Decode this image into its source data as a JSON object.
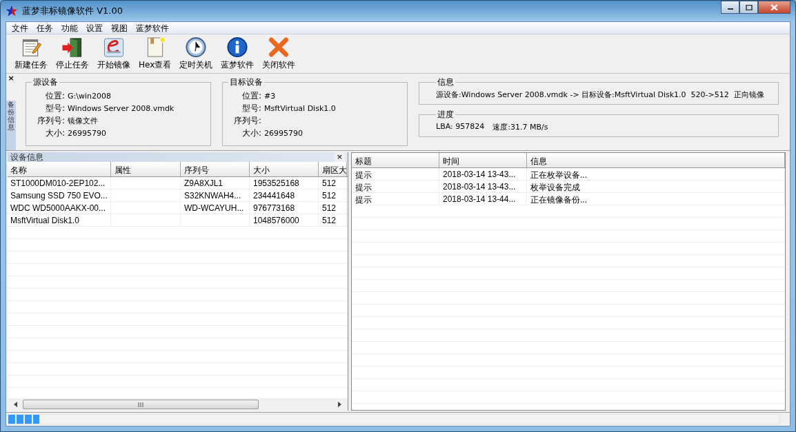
{
  "window": {
    "title": "蓝梦非标镜像软件 V1.00"
  },
  "menu": [
    "文件",
    "任务",
    "功能",
    "设置",
    "视图",
    "蓝梦软件"
  ],
  "toolbar": [
    {
      "label": "新建任务"
    },
    {
      "label": "停止任务"
    },
    {
      "label": "开始镜像"
    },
    {
      "label": "Hex查看"
    },
    {
      "label": "定时关机"
    },
    {
      "label": "蓝梦软件"
    },
    {
      "label": "关闭软件"
    }
  ],
  "side_tab": {
    "close": "×",
    "label": "备份信息"
  },
  "source": {
    "title": "源设备",
    "fields": [
      {
        "label": "位置:",
        "value": "G:\\win2008"
      },
      {
        "label": "型号:",
        "value": "Windows Server 2008.vmdk"
      },
      {
        "label": "序列号:",
        "value": "镜像文件"
      },
      {
        "label": "大小:",
        "value": "26995790"
      }
    ]
  },
  "target": {
    "title": "目标设备",
    "fields": [
      {
        "label": "位置:",
        "value": "#3"
      },
      {
        "label": "型号:",
        "value": "MsftVirtual Disk1.0"
      },
      {
        "label": "序列号:"
      },
      {
        "label": "大小:",
        "value": "26995790"
      }
    ]
  },
  "info": {
    "title": "信息",
    "text": "源设备:Windows Server 2008.vmdk -> 目标设备:MsftVirtual Disk1.0  520->512  正向镜像"
  },
  "progress": {
    "title": "进度",
    "lba": "LBA: 957824",
    "speed": "速度:31.7 MB/s"
  },
  "devices": {
    "title": "设备信息",
    "close": "×",
    "columns": [
      "名称",
      "属性",
      "序列号",
      "大小",
      "扇区大"
    ],
    "rows": [
      [
        "ST1000DM010-2EP102...",
        "",
        "Z9A8XJL1",
        "1953525168",
        "512"
      ],
      [
        "Samsung SSD 750 EVO...",
        "",
        "S32KNWAH4...",
        "234441648",
        "512"
      ],
      [
        "WDC WD5000AAKX-00...",
        "",
        "WD-WCAYUH...",
        "976773168",
        "512"
      ],
      [
        "MsftVirtual Disk1.0",
        "",
        "",
        "1048576000",
        "512"
      ]
    ]
  },
  "log": {
    "columns": [
      "标题",
      "时间",
      "信息"
    ],
    "rows": [
      [
        "提示",
        "2018-03-14 13-43...",
        "正在枚举设备..."
      ],
      [
        "提示",
        "2018-03-14 13-43...",
        "枚举设备完成"
      ],
      [
        "提示",
        "2018-03-14 13-44...",
        "正在镜像备份..."
      ]
    ]
  },
  "status_bar": {
    "level": 0.04
  }
}
